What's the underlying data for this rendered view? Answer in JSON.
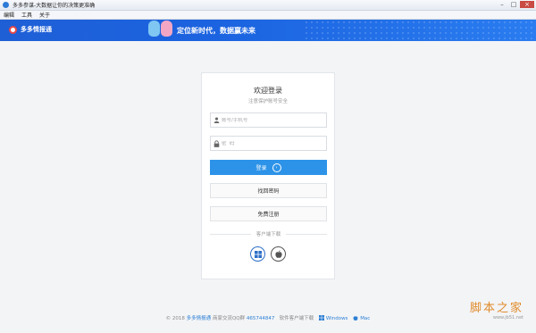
{
  "window": {
    "title": "多多参谋-大数据让你的决策更准确"
  },
  "menu": {
    "items": [
      "编辑",
      "工具",
      "关于"
    ]
  },
  "banner": {
    "logo_text": "多多情报通",
    "slogan": "定位新时代，数据赢未来"
  },
  "login": {
    "title": "欢迎登录",
    "subtitle": "注意保护账号安全",
    "username_placeholder": "账号/手机号",
    "password_placeholder": "密  码",
    "login_label": "登录",
    "forgot_label": "找回密码",
    "register_label": "免费注册",
    "download_label": "客户端下载"
  },
  "footer": {
    "copyright": "© 2018",
    "brand": "多多情报通",
    "qq_label": "商家交流QQ群",
    "qq_number": "465744847",
    "download_text": "软件客户端下载",
    "windows": "Windows",
    "mac": "Mac"
  },
  "watermark": {
    "main": "脚本之家",
    "url": "www.jb51.net"
  },
  "colors": {
    "accent": "#2d93e8",
    "banner": "#1f5fd6"
  }
}
